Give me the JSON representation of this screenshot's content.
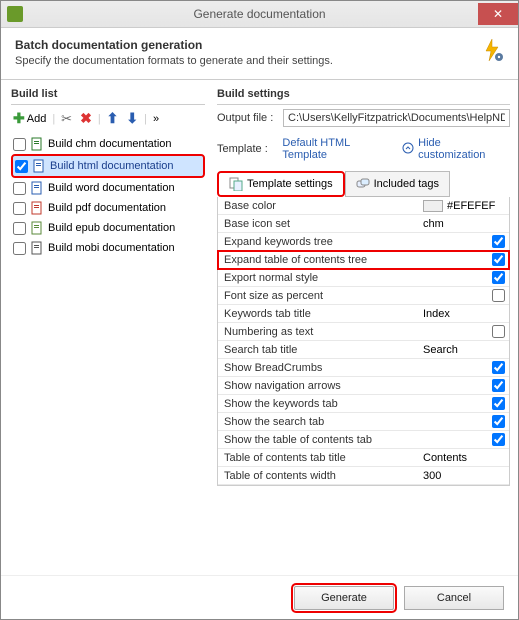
{
  "window": {
    "title": "Generate documentation"
  },
  "header": {
    "title": "Batch documentation generation",
    "subtitle": "Specify the documentation formats to generate and their settings."
  },
  "buildList": {
    "title": "Build list",
    "addLabel": "Add",
    "items": [
      {
        "label": "Build chm documentation",
        "checked": false,
        "color": "#2a7a2a"
      },
      {
        "label": "Build html documentation",
        "checked": true,
        "color": "#2a5db0",
        "highlighted": true
      },
      {
        "label": "Build word documentation",
        "checked": false,
        "color": "#2a5db0"
      },
      {
        "label": "Build pdf documentation",
        "checked": false,
        "color": "#c0392b"
      },
      {
        "label": "Build epub documentation",
        "checked": false,
        "color": "#5a8a3a"
      },
      {
        "label": "Build mobi documentation",
        "checked": false,
        "color": "#555555"
      }
    ]
  },
  "buildSettings": {
    "title": "Build settings",
    "outputLabel": "Output file :",
    "outputValue": "C:\\Users\\KellyFitzpatrick\\Documents\\HelpNDo…",
    "templateLabel": "Template :",
    "templateValue": "Default HTML Template",
    "hideCustom": "Hide customization",
    "tabs": {
      "templateSettings": "Template settings",
      "includedTags": "Included tags"
    },
    "rows": [
      {
        "name": "Base color",
        "type": "color",
        "value": "#EFEFEF"
      },
      {
        "name": "Base icon set",
        "type": "text",
        "value": "chm"
      },
      {
        "name": "Expand keywords tree",
        "type": "check",
        "value": true
      },
      {
        "name": "Expand table of contents tree",
        "type": "check",
        "value": true,
        "highlighted": true
      },
      {
        "name": "Export normal style",
        "type": "check",
        "value": true
      },
      {
        "name": "Font size as percent",
        "type": "check",
        "value": false
      },
      {
        "name": "Keywords tab title",
        "type": "text",
        "value": "Index"
      },
      {
        "name": "Numbering as text",
        "type": "check",
        "value": false
      },
      {
        "name": "Search tab title",
        "type": "text",
        "value": "Search"
      },
      {
        "name": "Show BreadCrumbs",
        "type": "check",
        "value": true
      },
      {
        "name": "Show navigation arrows",
        "type": "check",
        "value": true
      },
      {
        "name": "Show the keywords tab",
        "type": "check",
        "value": true
      },
      {
        "name": "Show the search tab",
        "type": "check",
        "value": true
      },
      {
        "name": "Show the table of contents tab",
        "type": "check",
        "value": true
      },
      {
        "name": "Table of contents tab title",
        "type": "text",
        "value": "Contents"
      },
      {
        "name": "Table of contents width",
        "type": "text",
        "value": "300"
      }
    ]
  },
  "footer": {
    "generate": "Generate",
    "cancel": "Cancel"
  }
}
